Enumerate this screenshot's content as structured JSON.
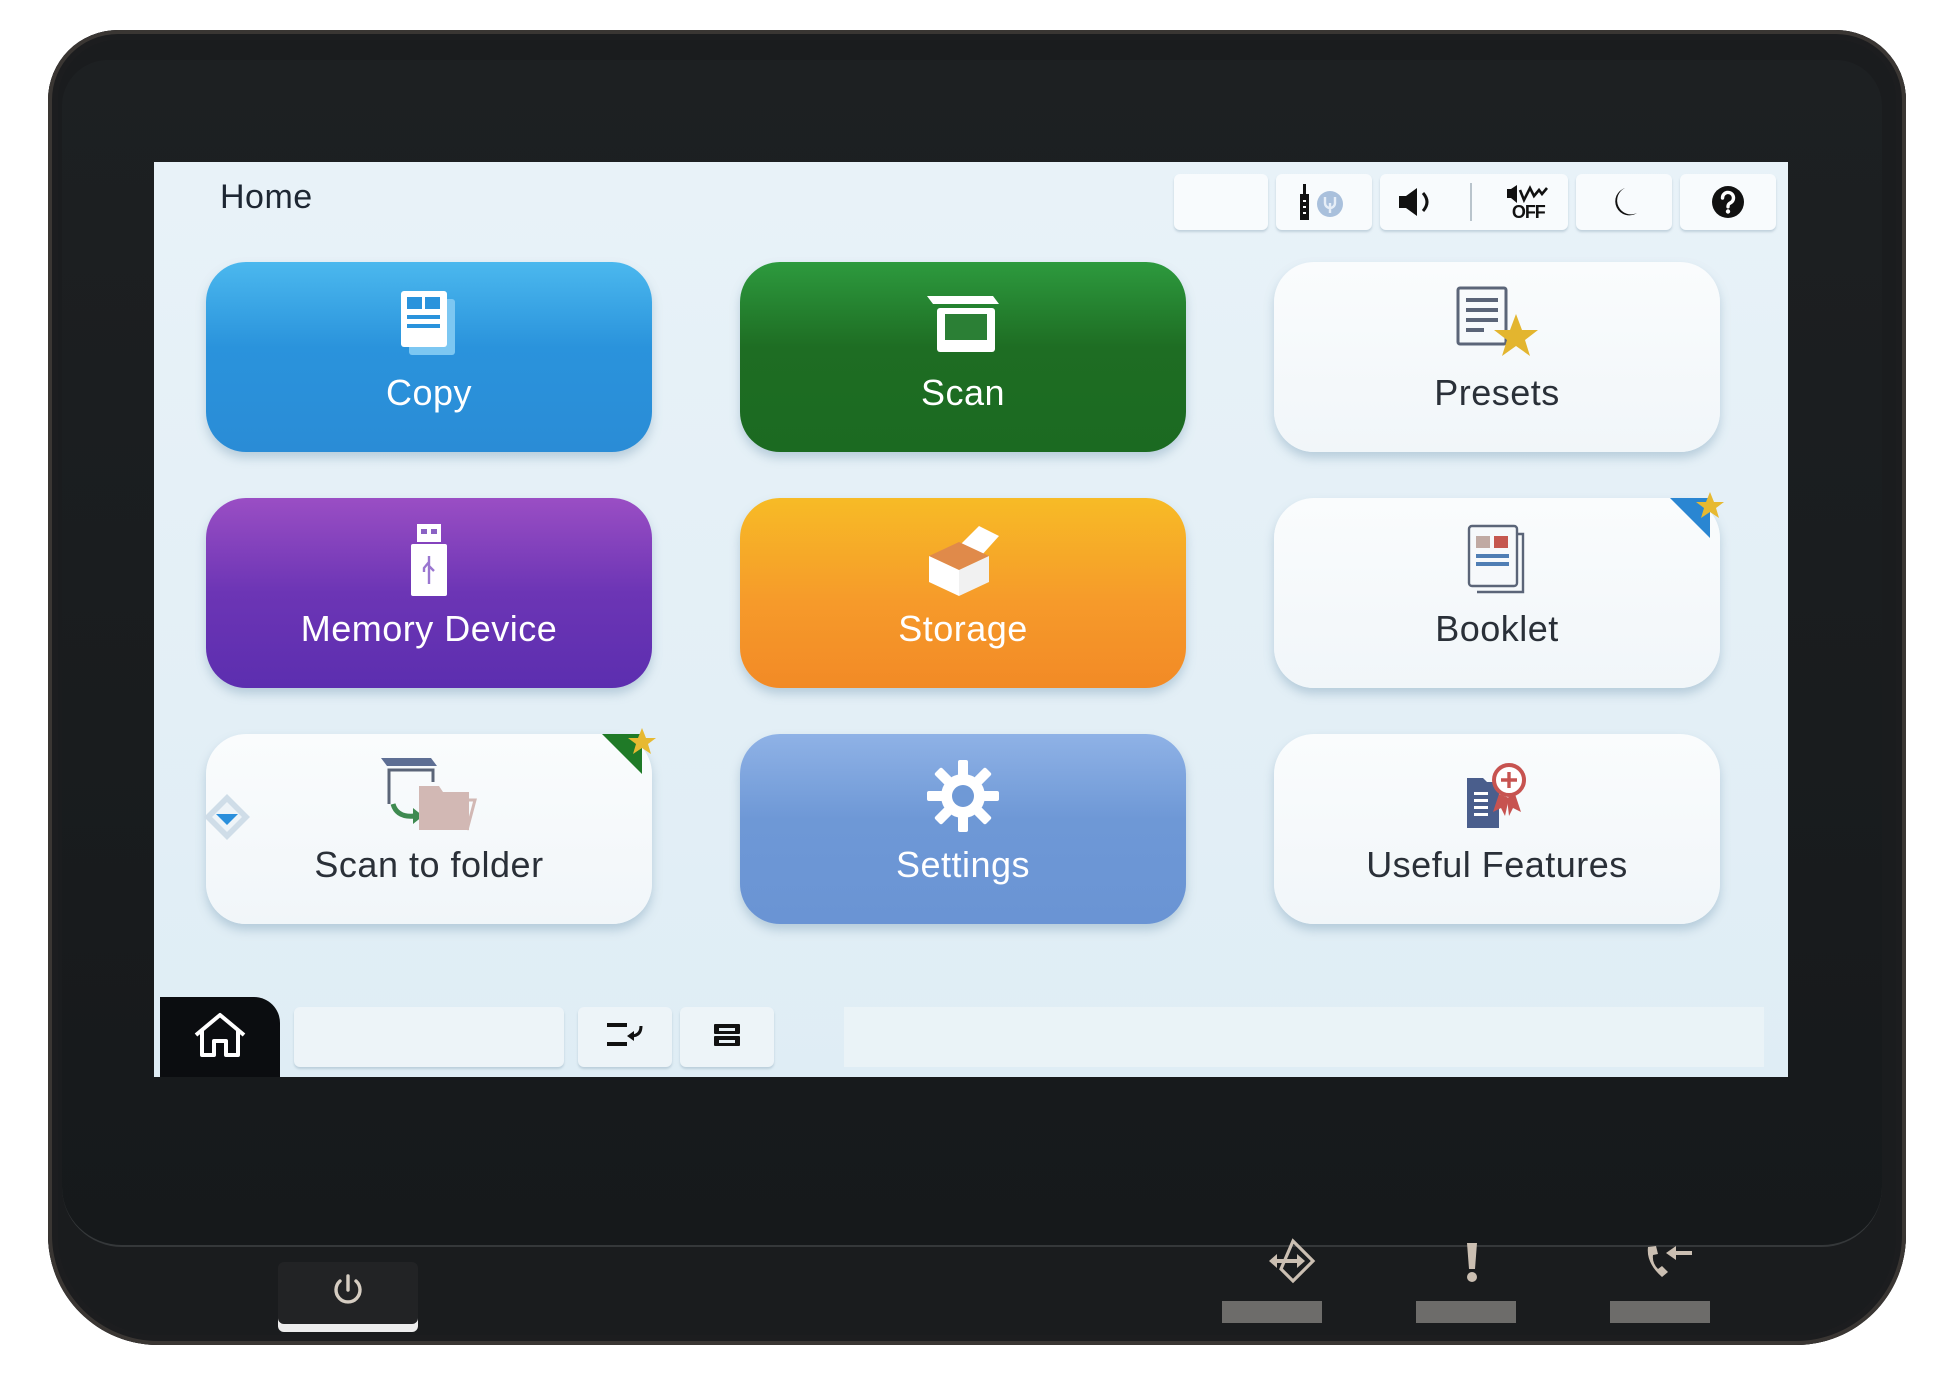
{
  "screen": {
    "title": "Home",
    "status_bar": {
      "blank_label": "",
      "network_icon": "network-status-icon",
      "volume_icon": "speaker-icon",
      "mute_icon": "sound-off-icon",
      "mute_label": "OFF",
      "sleep_icon": "moon-icon",
      "help_icon": "help-icon"
    },
    "tiles": [
      {
        "label": "Copy",
        "icon": "copy-icon",
        "style": "copy"
      },
      {
        "label": "Scan",
        "icon": "scanner-icon",
        "style": "scan"
      },
      {
        "label": "Presets",
        "icon": "presets-icon",
        "style": "light"
      },
      {
        "label": "Memory Device",
        "icon": "usb-icon",
        "style": "memory"
      },
      {
        "label": "Storage",
        "icon": "storage-box-icon",
        "style": "storage"
      },
      {
        "label": "Booklet",
        "icon": "booklet-icon",
        "style": "light",
        "preset_flag": "blue"
      },
      {
        "label": "Scan to folder",
        "icon": "scan-to-folder-icon",
        "style": "light",
        "preset_flag": "green"
      },
      {
        "label": "Settings",
        "icon": "gear-icon",
        "style": "settings"
      },
      {
        "label": "Useful Features",
        "icon": "useful-features-icon",
        "style": "light"
      }
    ],
    "page_indicator_icon": "diamond-page-indicator-icon",
    "bottom_bar": {
      "home_icon": "home-icon",
      "job_field_value": "",
      "job_list_icon": "job-list-icon",
      "job_status_icon": "job-status-icon",
      "message_text": ""
    }
  },
  "hardware_buttons": {
    "power_icon": "power-icon",
    "interrupt_icon": "interrupt-icon",
    "error_icon": "error-icon",
    "fax_icon": "fax-receive-icon"
  },
  "colors": {
    "copy": "#2a93dc",
    "scan": "#1e6d23",
    "memory_device": "#6c35b5",
    "storage": "#f69a2a",
    "settings": "#6e98d6",
    "star": "#e7b931",
    "bezel": "#1a1c1e"
  }
}
